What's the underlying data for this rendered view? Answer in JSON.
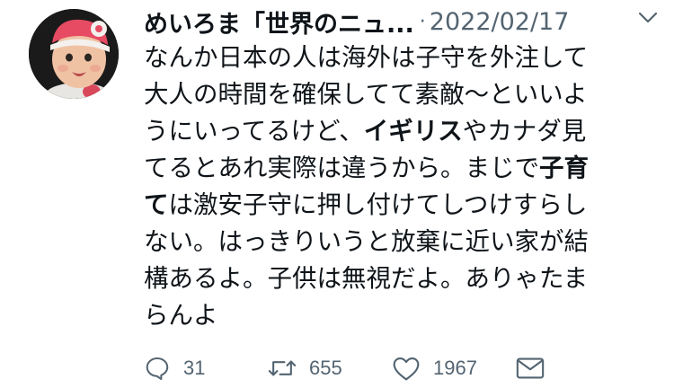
{
  "tweet": {
    "author_name": "めいろま「世界のニュ...",
    "separator": "·",
    "date": "2022/02/17",
    "body_lines": [
      [
        {
          "t": "なんか日本の人は海外は子守を外注して"
        }
      ],
      [
        {
          "t": "大人の時間を確保してて素敵〜といいよ"
        }
      ],
      [
        {
          "t": "うにいってるけど、"
        },
        {
          "t": "イギリス",
          "b": true
        },
        {
          "t": "やカナダ見"
        }
      ],
      [
        {
          "t": "てるとあれ実際は違うから。まじで"
        },
        {
          "t": "子育",
          "b": true
        }
      ],
      [
        {
          "t": "て",
          "b": true
        },
        {
          "t": "は激安子守に押し付けてしつけすらし"
        }
      ],
      [
        {
          "t": "ない。はっきりいうと放棄に近い家が結"
        }
      ],
      [
        {
          "t": "構あるよ。子供は無視だよ。ありゃたま"
        }
      ],
      [
        {
          "t": "らんよ"
        }
      ]
    ],
    "actions": {
      "reply_count": "31",
      "retweet_count": "655",
      "like_count": "1967"
    },
    "icons": {
      "more": "chevron-down-icon",
      "reply": "reply-icon",
      "retweet": "retweet-icon",
      "like": "heart-icon",
      "share": "share-mail-icon"
    },
    "colors": {
      "text": "#0f1419",
      "muted": "#536471"
    }
  }
}
